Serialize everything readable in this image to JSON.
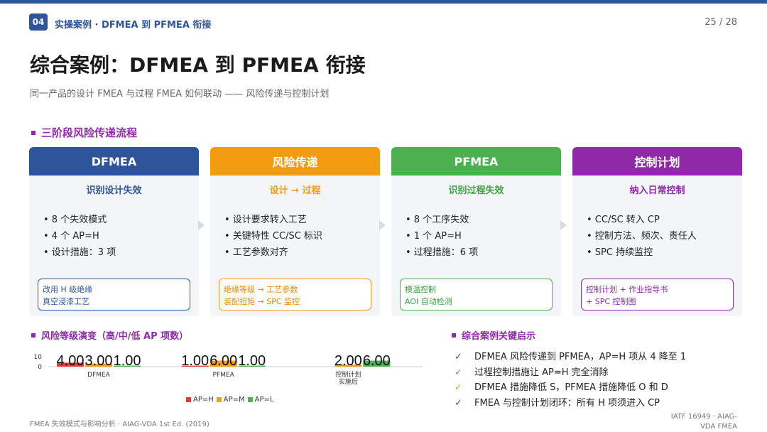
{
  "header": {
    "section_no": "04",
    "section_title": "实操案例 · DFMEA 到 PFMEA 衔接",
    "page": "25 / 28"
  },
  "title": "综合案例：DFMEA 到 PFMEA 衔接",
  "subtitle": "同一产品的设计 FMEA 与过程 FMEA 如何联动 —— 风险传递与控制计划",
  "flow_heading": "三阶段风险传递流程",
  "colors": {
    "blue": "#2e5597",
    "orange": "#f39c12",
    "green": "#4caf50",
    "purple": "#8e2aa8",
    "red": "#e53935"
  },
  "cards": [
    {
      "title": "DFMEA",
      "subtitle": "识别设计失效",
      "items": [
        "• 8 个失效模式",
        "• 4 个 AP=H",
        "• 设计措施：3 项"
      ],
      "note": [
        "改用 H 级绝缘",
        "真空浸漆工艺"
      ]
    },
    {
      "title": "风险传递",
      "subtitle": "设计 → 过程",
      "items": [
        "• 设计要求转入工艺",
        "• 关键特性 CC/SC 标识",
        "• 工艺参数对齐"
      ],
      "note": [
        "绝缘等级 → 工艺参数",
        "装配扭矩 → SPC 监控"
      ]
    },
    {
      "title": "PFMEA",
      "subtitle": "识别过程失效",
      "items": [
        "• 8 个工序失效",
        "• 1 个 AP=H",
        "• 过程措施：6 项"
      ],
      "note": [
        "模温控制",
        "AOI 自动检测"
      ]
    },
    {
      "title": "控制计划",
      "subtitle": "纳入日常控制",
      "items": [
        "• CC/SC 转入 CP",
        "• 控制方法、频次、责任人",
        "• SPC 持续监控"
      ],
      "note": [
        "控制计划 + 作业指导书",
        "+ SPC 控制图"
      ]
    }
  ],
  "chart_heading": "风险等级演变（高/中/低 AP 项数）",
  "chart_data": {
    "type": "bar",
    "title": "风险等级演变（高/中/低 AP 项数）",
    "categories": [
      "DFMEA",
      "PFMEA",
      "控制计划实施后"
    ],
    "category_lines": [
      [
        "DFMEA"
      ],
      [
        "PFMEA"
      ],
      [
        "控制计划",
        "实施后"
      ]
    ],
    "series": [
      {
        "name": "AP=H",
        "values": [
          4,
          1,
          0
        ],
        "labels": [
          "4.00",
          "1.00",
          ""
        ],
        "color": "#e53935"
      },
      {
        "name": "AP=M",
        "values": [
          3,
          6,
          2
        ],
        "labels": [
          "3.00",
          "6.00",
          "2.00"
        ],
        "color": "#f39c12"
      },
      {
        "name": "AP=L",
        "values": [
          1,
          1,
          6
        ],
        "labels": [
          "1.00",
          "1.00",
          "6.00"
        ],
        "color": "#4caf50"
      }
    ],
    "yticks": [
      "10",
      "0"
    ],
    "ylim": [
      0,
      10
    ],
    "legend": "bottom"
  },
  "insights_heading": "综合案例关键启示",
  "insights": [
    {
      "icon": "check-icon",
      "mark": "✓",
      "color": "#2e5597",
      "text": "DFMEA 风险传递到 PFMEA，AP=H 项从 4 降至 1"
    },
    {
      "icon": "check-icon",
      "mark": "✓",
      "color": "#4caf50",
      "text": "过程控制措施让 AP=H 完全消除"
    },
    {
      "icon": "check-icon",
      "mark": "✓",
      "color": "#f39c12",
      "text": "DFMEA 措施降低 S，PFMEA 措施降低 O 和 D"
    },
    {
      "icon": "check-icon",
      "mark": "✓",
      "color": "#8e2aa8",
      "text": "FMEA 与控制计划闭环：所有 H 项须进入 CP"
    }
  ],
  "footer": {
    "left": "FMEA 失效模式与影响分析 · AIAG-VDA 1st Ed. (2019)",
    "right_1": "IATF 16949 · AIAG-",
    "right_2": "VDA FMEA"
  }
}
